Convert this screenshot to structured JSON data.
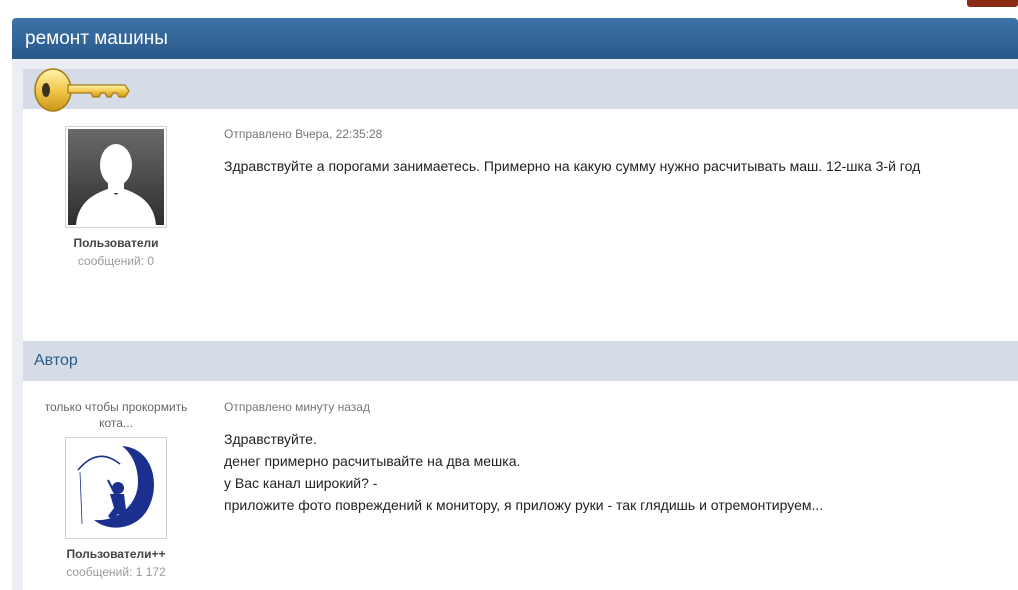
{
  "topic": {
    "title": "ремонт машины"
  },
  "posts": [
    {
      "author_name": "",
      "author_title": "",
      "group": "Пользователи",
      "post_count": "сообщений: 0",
      "date": "Отправлено Вчера, 22:35:28",
      "lines": [
        "Здравствуйте а порогами занимаетесь. Примерно на какую сумму нужно расчитывать маш. 12-шка 3-й год"
      ]
    },
    {
      "author_name": "Автор",
      "author_title": "только чтобы прокормить кота...",
      "group": "Пользователи++",
      "post_count": "сообщений: 1 172",
      "date": "Отправлено минуту назад",
      "lines": [
        "Здравствуйте.",
        "денег примерно расчитывайте на два мешка.",
        "у Вас канал широкий? -",
        "приложите фото повреждений к монитору, я приложу руки - так глядишь и отремонтируем..."
      ]
    }
  ],
  "colors": {
    "header": "#2f6196",
    "bar": "#d6dce6",
    "key": "#f2c94c"
  },
  "icons": {
    "post1_badge": "key-icon",
    "post1_avatar": "default-avatar-silhouette",
    "post2_avatar": "moon-fisherman-avatar"
  }
}
